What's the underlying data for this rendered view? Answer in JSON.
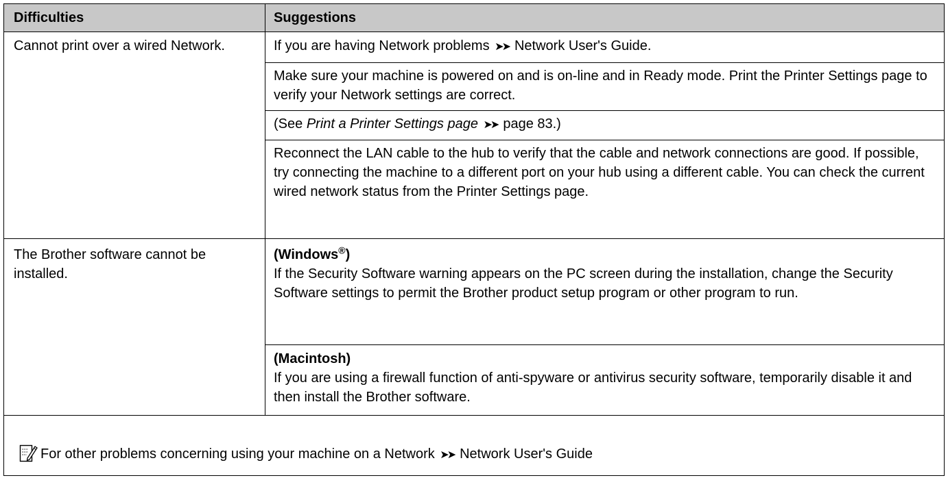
{
  "table": {
    "headers": [
      "Difficulties",
      "Suggestions"
    ],
    "row1": {
      "difficulty": "Cannot print over a wired Network.",
      "s1_pre": "If you are having Network problems",
      "s1_post": "Network User's Guide.",
      "s2": "Make sure your machine is powered on and is on-line and in Ready mode. Print the Printer Settings page to verify your Network settings are correct.",
      "s3_pre": "(See ",
      "s3_link": "Print a Printer Settings page",
      "s3_post": "page 83.)",
      "s4": "Reconnect the LAN cable to the hub to verify that the cable and network connections are good. If possible, try connecting the machine to a different port on your hub using a different cable. You can check the current wired network status from the Printer Settings page."
    },
    "row2": {
      "difficulty": "The Brother software cannot be installed.",
      "win_heading": "(Windows",
      "win_reg": "®",
      "win_close": ")",
      "win_text": "If the Security Software warning appears on the PC screen during the installation, change the Security Software settings to permit the Brother product setup program or other program to run.",
      "mac_heading": "(Macintosh)",
      "mac_text": "If you are using a firewall function of anti-spyware or antivirus security software, temporarily disable it and then install the Brother software."
    },
    "note": {
      "icon": "note-pencil-icon",
      "pre": "For other problems concerning using your machine on a Network",
      "post": "Network User's Guide"
    },
    "arrow_glyph": "➤➤"
  }
}
